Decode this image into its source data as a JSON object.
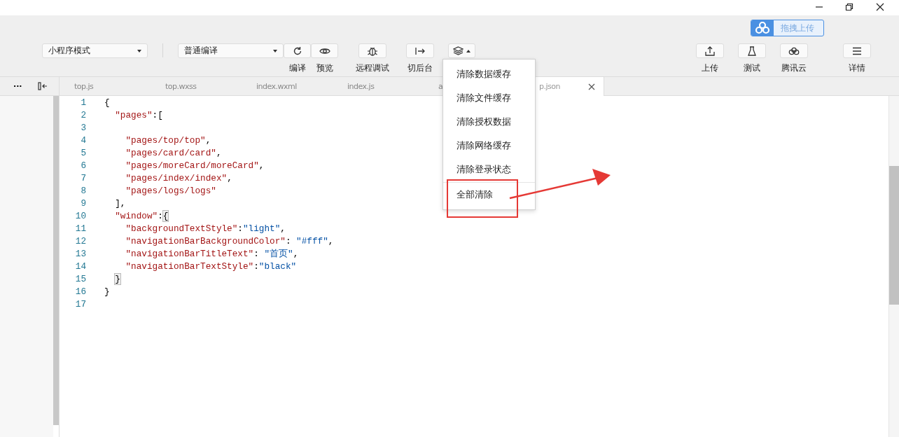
{
  "upload_badge": {
    "label": "拖拽上传"
  },
  "toolbar": {
    "mode_select": {
      "value": "小程序模式"
    },
    "compile_select": {
      "value": "普通编译"
    },
    "left_tools": [
      {
        "kind": "refresh",
        "label": "编译"
      },
      {
        "kind": "eye",
        "label": "预览"
      },
      {
        "kind": "bug",
        "label": "远程调试"
      },
      {
        "kind": "exit",
        "label": "切后台"
      },
      {
        "kind": "layers"
      }
    ],
    "right_tools": [
      {
        "kind": "upload",
        "label": "上传"
      },
      {
        "kind": "flask",
        "label": "测试"
      },
      {
        "kind": "cloud",
        "label": "腾讯云"
      },
      {
        "kind": "menu",
        "label": "详情"
      }
    ]
  },
  "sidebar_header": {
    "more": "···"
  },
  "tabs": [
    {
      "label": "top.js",
      "selected": false
    },
    {
      "label": "top.wxss",
      "selected": false
    },
    {
      "label": "index.wxml",
      "selected": false
    },
    {
      "label": "index.js",
      "selected": false
    },
    {
      "label": "a",
      "selected": false
    },
    {
      "label": "p.json",
      "selected": true
    }
  ],
  "editor": {
    "lines": [
      {
        "number": "1",
        "tokens": [
          {
            "kind": "punct",
            "text": "{"
          }
        ]
      },
      {
        "number": "2",
        "tokens": [
          {
            "kind": "key",
            "text": "  \"pages\""
          },
          {
            "kind": "punct",
            "text": ":["
          }
        ]
      },
      {
        "number": "3"
      },
      {
        "number": "4",
        "tokens": [
          {
            "kind": "key",
            "text": "    \"pages/top/top\""
          },
          {
            "kind": "punct",
            "text": ","
          }
        ]
      },
      {
        "number": "5",
        "tokens": [
          {
            "kind": "key",
            "text": "    \"pages/card/card\""
          },
          {
            "kind": "punct",
            "text": ","
          }
        ]
      },
      {
        "number": "6",
        "tokens": [
          {
            "kind": "key",
            "text": "    \"pages/moreCard/moreCard\""
          },
          {
            "kind": "punct",
            "text": ","
          }
        ]
      },
      {
        "number": "7",
        "tokens": [
          {
            "kind": "key",
            "text": "    \"pages/index/index\""
          },
          {
            "kind": "punct",
            "text": ","
          }
        ]
      },
      {
        "number": "8",
        "tokens": [
          {
            "kind": "key",
            "text": "    \"pages/logs/logs\""
          }
        ]
      },
      {
        "number": "9",
        "tokens": [
          {
            "kind": "punct",
            "text": "  ],"
          }
        ]
      },
      {
        "number": "10",
        "tokens": [
          {
            "kind": "key",
            "text": "  \"window\""
          },
          {
            "kind": "punct",
            "text": ":"
          },
          {
            "kind": "match",
            "text": "{"
          }
        ]
      },
      {
        "number": "11",
        "tokens": [
          {
            "kind": "key",
            "text": "    \"backgroundTextStyle\""
          },
          {
            "kind": "punct",
            "text": ":"
          },
          {
            "kind": "value",
            "text": "\"light\""
          },
          {
            "kind": "punct",
            "text": ","
          }
        ]
      },
      {
        "number": "12",
        "tokens": [
          {
            "kind": "key",
            "text": "    \"navigationBarBackgroundColor\""
          },
          {
            "kind": "punct",
            "text": ": "
          },
          {
            "kind": "value",
            "text": "\"#fff\""
          },
          {
            "kind": "punct",
            "text": ","
          }
        ]
      },
      {
        "number": "13",
        "tokens": [
          {
            "kind": "key",
            "text": "    \"navigationBarTitleText\""
          },
          {
            "kind": "punct",
            "text": ": "
          },
          {
            "kind": "value",
            "text": "\"首页\""
          },
          {
            "kind": "punct",
            "text": ","
          }
        ]
      },
      {
        "number": "14",
        "tokens": [
          {
            "kind": "key",
            "text": "    \"navigationBarTextStyle\""
          },
          {
            "kind": "punct",
            "text": ":"
          },
          {
            "kind": "value",
            "text": "\"black\""
          }
        ]
      },
      {
        "number": "15",
        "tokens": [
          {
            "kind": "match",
            "text": "}"
          }
        ]
      },
      {
        "number": "16",
        "tokens": [
          {
            "kind": "punct",
            "text": "}"
          }
        ]
      },
      {
        "number": "17"
      }
    ]
  },
  "menu": {
    "items": [
      {
        "label": "清除数据缓存",
        "annotated": false,
        "divider_before": false
      },
      {
        "label": "清除文件缓存",
        "annotated": false,
        "divider_before": false
      },
      {
        "label": "清除授权数据",
        "annotated": false,
        "divider_before": false
      },
      {
        "label": "清除网络缓存",
        "annotated": false,
        "divider_before": false
      },
      {
        "label": "清除登录状态",
        "annotated": false,
        "divider_before": false
      },
      {
        "label": "全部清除",
        "annotated": true,
        "divider_before": true
      }
    ]
  }
}
